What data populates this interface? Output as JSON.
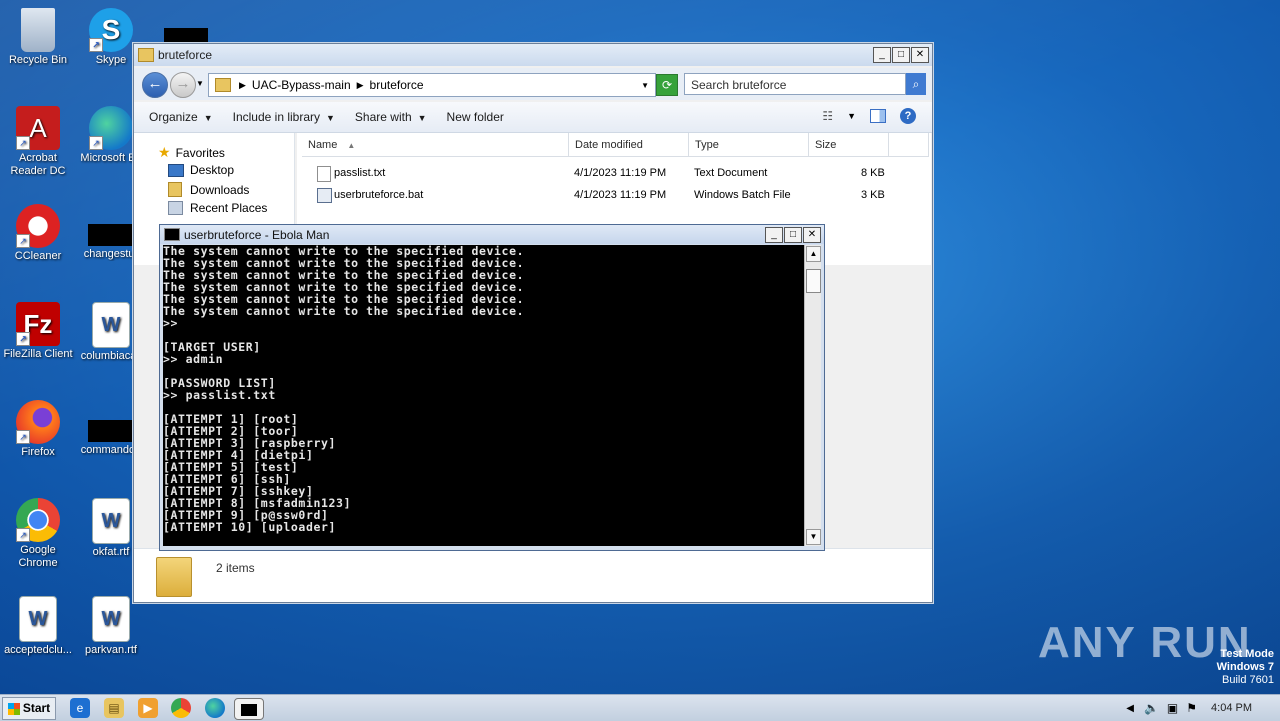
{
  "desktop": {
    "icons": [
      {
        "label": "Recycle Bin"
      },
      {
        "label": "Skype"
      },
      {
        "label": "Acrobat Reader DC"
      },
      {
        "label": "Microsoft Ed"
      },
      {
        "label": "CCleaner"
      },
      {
        "label": "changestur"
      },
      {
        "label": "FileZilla Client"
      },
      {
        "label": "columbiacali"
      },
      {
        "label": "Firefox"
      },
      {
        "label": "commandqu"
      },
      {
        "label": "Google Chrome"
      },
      {
        "label": "okfat.rtf"
      },
      {
        "label": "acceptedclu..."
      },
      {
        "label": "parkvan.rtf"
      }
    ]
  },
  "explorer": {
    "title": "bruteforce",
    "breadcrumb": [
      "UAC-Bypass-main",
      "bruteforce"
    ],
    "search_placeholder": "Search bruteforce",
    "toolbar": {
      "organize": "Organize",
      "include": "Include in library",
      "share": "Share with",
      "new_folder": "New folder"
    },
    "nav": {
      "favorites": "Favorites",
      "desktop": "Desktop",
      "downloads": "Downloads",
      "recent": "Recent Places"
    },
    "columns": {
      "name": "Name",
      "date": "Date modified",
      "type": "Type",
      "size": "Size"
    },
    "files": [
      {
        "name": "passlist.txt",
        "date": "4/1/2023 11:19 PM",
        "type": "Text Document",
        "size": "8 KB"
      },
      {
        "name": "userbruteforce.bat",
        "date": "4/1/2023 11:19 PM",
        "type": "Windows Batch File",
        "size": "3 KB"
      }
    ],
    "status": "2 items"
  },
  "console": {
    "title": "userbruteforce - Ebola Man",
    "lines": [
      "The system cannot write to the specified device.",
      "The system cannot write to the specified device.",
      "The system cannot write to the specified device.",
      "The system cannot write to the specified device.",
      "The system cannot write to the specified device.",
      "The system cannot write to the specified device.",
      ">>",
      "",
      "[TARGET USER]",
      ">> admin",
      "",
      "[PASSWORD LIST]",
      ">> passlist.txt",
      "",
      "[ATTEMPT 1] [root]",
      "[ATTEMPT 2] [toor]",
      "[ATTEMPT 3] [raspberry]",
      "[ATTEMPT 4] [dietpi]",
      "[ATTEMPT 5] [test]",
      "[ATTEMPT 6] [ssh]",
      "[ATTEMPT 7] [sshkey]",
      "[ATTEMPT 8] [msfadmin123]",
      "[ATTEMPT 9] [p@ssw0rd]",
      "[ATTEMPT 10] [uploader]"
    ]
  },
  "taskbar": {
    "start": "Start",
    "clock": "4:04 PM"
  },
  "watermark": {
    "line1": "Test Mode",
    "line2": "Windows 7",
    "line3": "Build 7601",
    "brand": "ANY RUN"
  }
}
